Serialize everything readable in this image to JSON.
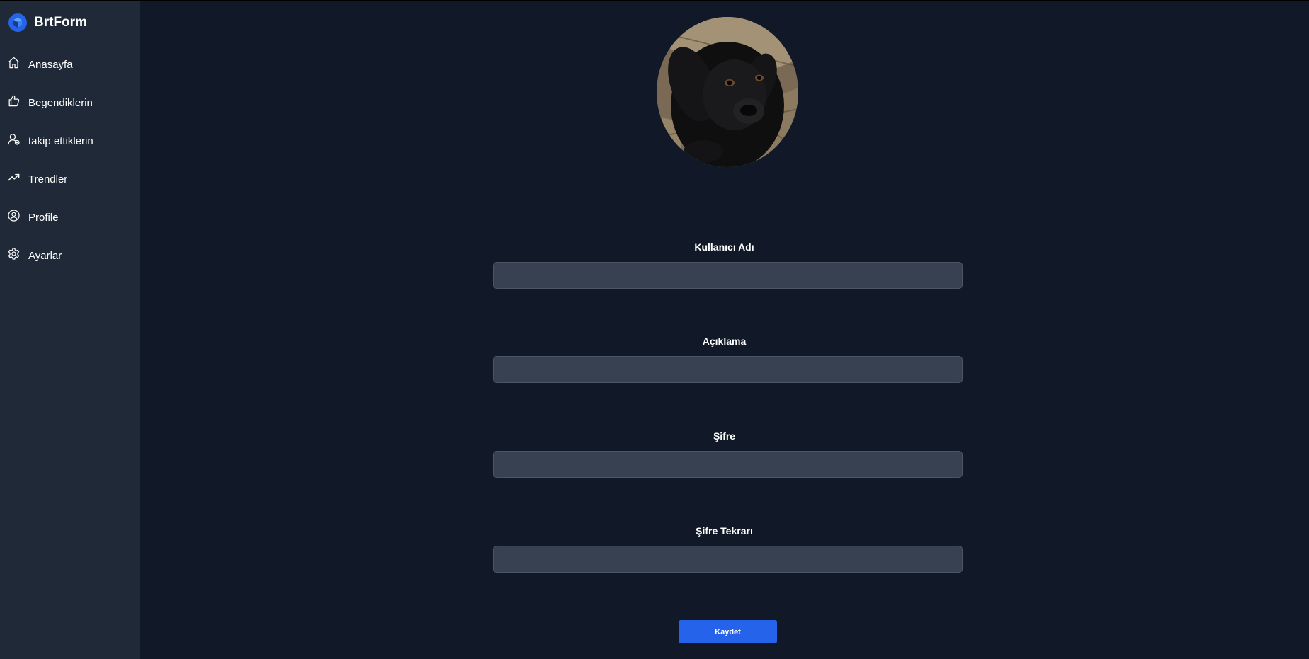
{
  "app": {
    "name": "BrtForm"
  },
  "sidebar": {
    "items": [
      {
        "label": "Anasayfa",
        "icon": "home-icon"
      },
      {
        "label": "Begendiklerin",
        "icon": "thumbs-up-icon"
      },
      {
        "label": "takip ettiklerin",
        "icon": "user-follow-icon"
      },
      {
        "label": "Trendler",
        "icon": "trending-icon"
      },
      {
        "label": "Profile",
        "icon": "user-circle-icon"
      },
      {
        "label": "Ayarlar",
        "icon": "gear-icon"
      }
    ]
  },
  "profile_form": {
    "avatar": "profile-photo-black-dog",
    "fields": [
      {
        "label": "Kullanıcı Adı",
        "value": "",
        "placeholder": ""
      },
      {
        "label": "Açıklama",
        "value": "",
        "placeholder": ""
      },
      {
        "label": "Şifre",
        "value": "",
        "placeholder": ""
      },
      {
        "label": "Şifre Tekrarı",
        "value": "",
        "placeholder": ""
      }
    ],
    "save_label": "Kaydet"
  },
  "colors": {
    "background": "#111827",
    "sidebar": "#1f2937",
    "input": "#374151",
    "accent": "#2563eb"
  }
}
